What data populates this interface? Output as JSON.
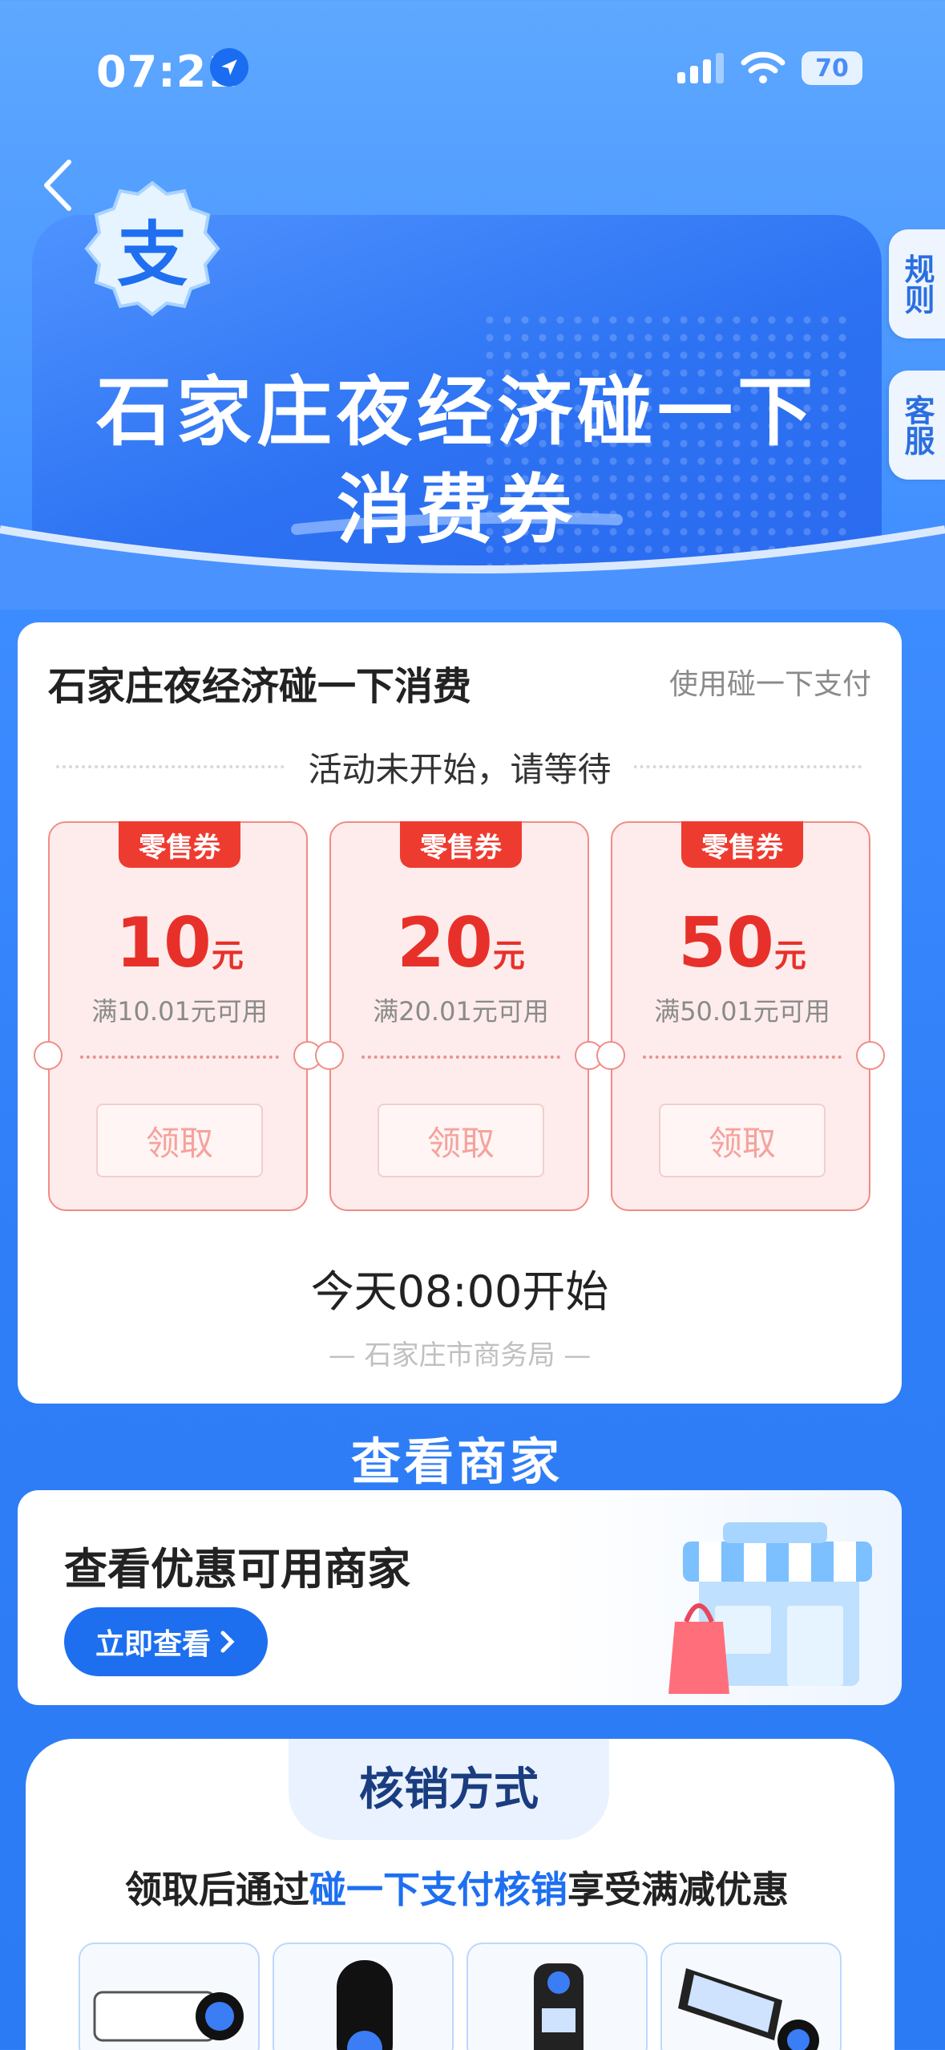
{
  "status_bar": {
    "time": "07:21",
    "battery": "70"
  },
  "hero": {
    "badge_char": "支",
    "title_line1": "石家庄夜经济碰一下",
    "title_line2": "消费券"
  },
  "side_tabs": {
    "rules": "规则",
    "service": "客服"
  },
  "activity_card": {
    "title": "石家庄夜经济碰一下消费",
    "pay_link": "使用碰一下支付",
    "status": "活动未开始，请等待",
    "coupons": [
      {
        "tag": "零售券",
        "amount": "10",
        "unit": "元",
        "condition": "满10.01元可用",
        "button": "领取"
      },
      {
        "tag": "零售券",
        "amount": "20",
        "unit": "元",
        "condition": "满20.01元可用",
        "button": "领取"
      },
      {
        "tag": "零售券",
        "amount": "50",
        "unit": "元",
        "condition": "满50.01元可用",
        "button": "领取"
      }
    ],
    "start_time": "今天08:00开始",
    "organizer": "— 石家庄市商务局 —"
  },
  "merchant_section": {
    "title": "查看商家",
    "card_title": "查看优惠可用商家",
    "button": "立即查看"
  },
  "redeem_section": {
    "title": "核销方式",
    "subtitle_pre": "领取后通过",
    "subtitle_highlight": "碰一下支付核销",
    "subtitle_post": "享受满减优惠"
  },
  "colors": {
    "brand_blue": "#1e6ff0",
    "coupon_red": "#e8302a",
    "background_blue": "#3d8cff"
  }
}
